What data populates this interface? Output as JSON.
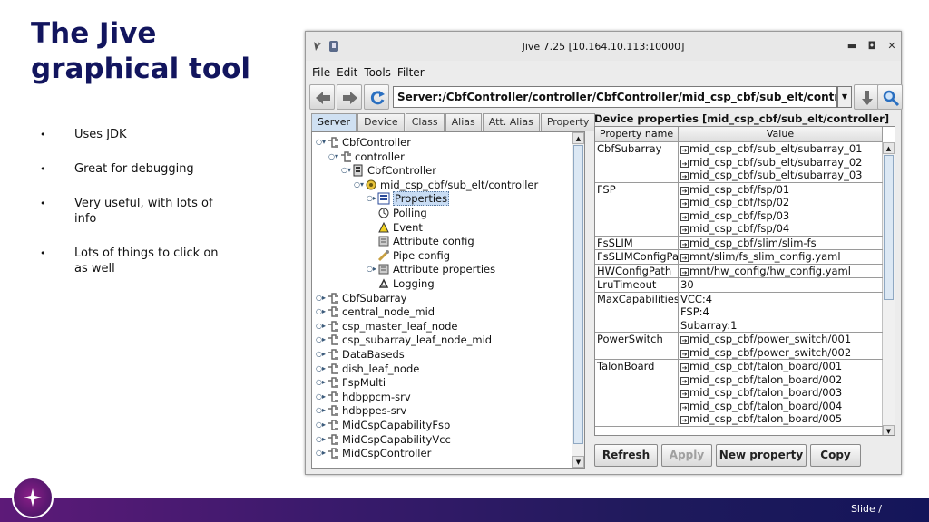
{
  "slide": {
    "title": "The Jive graphical tool",
    "bullets": [
      "Uses JDK",
      "Great for debugging",
      "Very useful, with lots of info",
      "Lots of things to click on as well"
    ],
    "footer_text": "Slide  /"
  },
  "window": {
    "title": "Jive 7.25 [10.164.10.113:10000]",
    "menu": [
      "File",
      "Edit",
      "Tools",
      "Filter"
    ],
    "address": "Server:/CbfController/controller/CbfController/mid_csp_cbf/sub_elt/controller/Properties",
    "tabs": [
      "Server",
      "Device",
      "Class",
      "Alias",
      "Att. Alias",
      "Property"
    ],
    "tree": [
      {
        "label": "CbfController",
        "toggle": "open",
        "icon": "node"
      },
      {
        "label": "controller",
        "toggle": "open",
        "icon": "node"
      },
      {
        "label": "CbfController",
        "toggle": "open",
        "icon": "server"
      },
      {
        "label": "mid_csp_cbf/sub_elt/controller",
        "toggle": "open",
        "icon": "device"
      },
      {
        "label": "Properties",
        "toggle": "closed",
        "icon": "props",
        "selected": true
      },
      {
        "label": "Polling",
        "toggle": "",
        "icon": "polling"
      },
      {
        "label": "Event",
        "toggle": "",
        "icon": "event"
      },
      {
        "label": "Attribute config",
        "toggle": "",
        "icon": "attr"
      },
      {
        "label": "Pipe config",
        "toggle": "",
        "icon": "pipe"
      },
      {
        "label": "Attribute properties",
        "toggle": "closed",
        "icon": "attr"
      },
      {
        "label": "Logging",
        "toggle": "",
        "icon": "logging"
      },
      {
        "label": "CbfSubarray",
        "toggle": "closed",
        "icon": "node"
      },
      {
        "label": "central_node_mid",
        "toggle": "closed",
        "icon": "node"
      },
      {
        "label": "csp_master_leaf_node",
        "toggle": "closed",
        "icon": "node"
      },
      {
        "label": "csp_subarray_leaf_node_mid",
        "toggle": "closed",
        "icon": "node"
      },
      {
        "label": "DataBaseds",
        "toggle": "closed",
        "icon": "node"
      },
      {
        "label": "dish_leaf_node",
        "toggle": "closed",
        "icon": "node"
      },
      {
        "label": "FspMulti",
        "toggle": "closed",
        "icon": "node"
      },
      {
        "label": "hdbppcm-srv",
        "toggle": "closed",
        "icon": "node"
      },
      {
        "label": "hdbppes-srv",
        "toggle": "closed",
        "icon": "node"
      },
      {
        "label": "MidCspCapabilityFsp",
        "toggle": "closed",
        "icon": "node"
      },
      {
        "label": "MidCspCapabilityVcc",
        "toggle": "closed",
        "icon": "node"
      },
      {
        "label": "MidCspController",
        "toggle": "closed",
        "icon": "node"
      }
    ],
    "props_title": "Device properties [mid_csp_cbf/sub_elt/controller]",
    "table_headers": [
      "Property name",
      "Value"
    ],
    "properties": [
      {
        "name": "CbfSubarray",
        "values": [
          "mid_csp_cbf/sub_elt/subarray_01",
          "mid_csp_cbf/sub_elt/subarray_02",
          "mid_csp_cbf/sub_elt/subarray_03"
        ],
        "link": true
      },
      {
        "name": "FSP",
        "values": [
          "mid_csp_cbf/fsp/01",
          "mid_csp_cbf/fsp/02",
          "mid_csp_cbf/fsp/03",
          "mid_csp_cbf/fsp/04"
        ],
        "link": true
      },
      {
        "name": "FsSLIM",
        "values": [
          "mid_csp_cbf/slim/slim-fs"
        ],
        "link": true
      },
      {
        "name": "FsSLIMConfigPath",
        "values": [
          "mnt/slim/fs_slim_config.yaml"
        ],
        "link": true
      },
      {
        "name": "HWConfigPath",
        "values": [
          "mnt/hw_config/hw_config.yaml"
        ],
        "link": true
      },
      {
        "name": "LruTimeout",
        "values": [
          "30"
        ],
        "link": false
      },
      {
        "name": "MaxCapabilities",
        "values": [
          "VCC:4",
          "FSP:4",
          "Subarray:1"
        ],
        "link": false
      },
      {
        "name": "PowerSwitch",
        "values": [
          "mid_csp_cbf/power_switch/001",
          "mid_csp_cbf/power_switch/002"
        ],
        "link": true
      },
      {
        "name": "TalonBoard",
        "values": [
          "mid_csp_cbf/talon_board/001",
          "mid_csp_cbf/talon_board/002",
          "mid_csp_cbf/talon_board/003",
          "mid_csp_cbf/talon_board/004",
          "mid_csp_cbf/talon_board/005"
        ],
        "link": true
      }
    ],
    "buttons": {
      "refresh": "Refresh",
      "apply": "Apply",
      "new_property": "New property",
      "copy": "Copy"
    }
  }
}
